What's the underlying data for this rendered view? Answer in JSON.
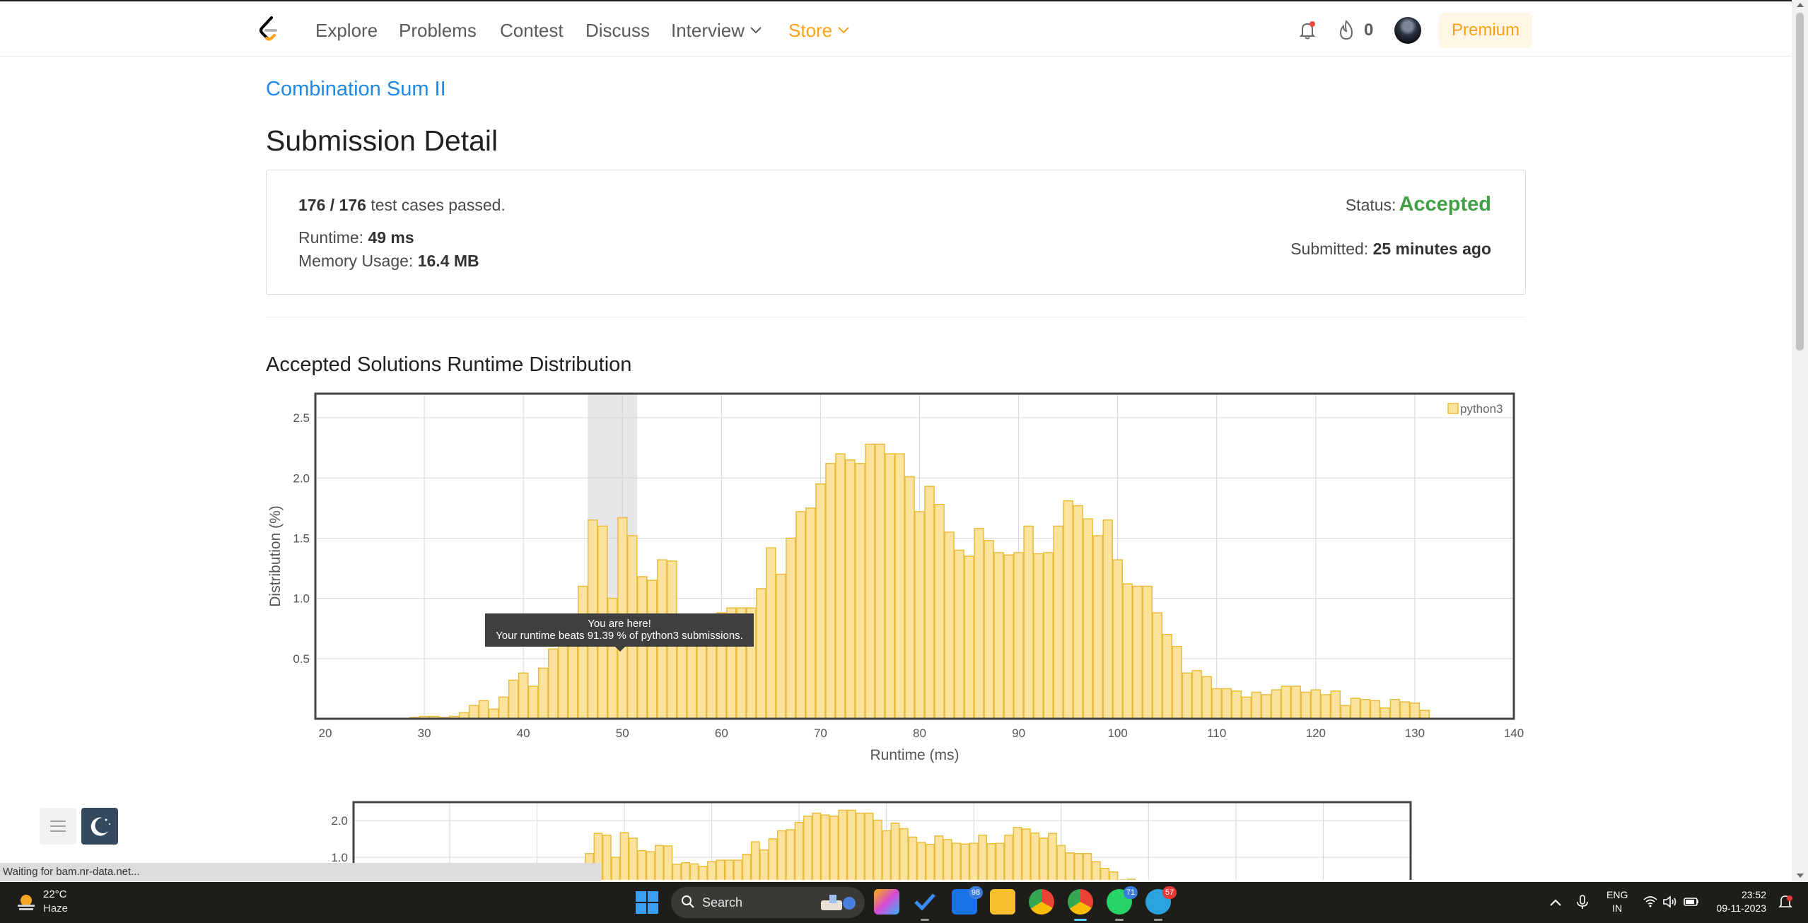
{
  "nav": {
    "links": [
      "Explore",
      "Problems",
      "Contest",
      "Discuss",
      "Interview",
      "Store"
    ],
    "streak_count": "0",
    "premium_label": "Premium"
  },
  "problem": {
    "title": "Combination Sum II"
  },
  "page_title": "Submission Detail",
  "summary": {
    "passed": "176 / 176",
    "passed_suffix": "test cases passed.",
    "runtime_label": "Runtime:",
    "runtime_value": "49 ms",
    "memory_label": "Memory Usage:",
    "memory_value": "16.4 MB",
    "status_label": "Status:",
    "status_value": "Accepted",
    "submitted_label": "Submitted:",
    "submitted_value": "25 minutes ago"
  },
  "distribution_title": "Accepted Solutions Runtime Distribution",
  "tooltip": {
    "line1": "You are here!",
    "line2": "Your runtime beats 91.39 % of python3 submissions."
  },
  "colors": {
    "accent": "#ffa116",
    "link": "#1e88e5",
    "accepted": "#43a047",
    "bar_fill": "#fbe29d",
    "bar_stroke": "#e8bd3a"
  },
  "chart_data": [
    {
      "type": "bar",
      "xlabel": "Runtime (ms)",
      "ylabel": "Distribution (%)",
      "xlim": [
        19,
        140
      ],
      "ylim": [
        0,
        2.7
      ],
      "x_ticks": [
        20,
        30,
        40,
        50,
        60,
        70,
        80,
        90,
        100,
        110,
        120,
        130,
        140
      ],
      "y_ticks": [
        0.5,
        1.0,
        1.5,
        2.0,
        2.5
      ],
      "y_tick_labels": [
        "0.5",
        "1.0",
        "1.5",
        "2.0",
        "2.5"
      ],
      "grid": true,
      "legend": "top-right",
      "highlight_range": [
        47,
        51
      ],
      "series": [
        {
          "name": "python3",
          "x": [
            29,
            30,
            31,
            32,
            33,
            34,
            35,
            36,
            37,
            38,
            39,
            40,
            41,
            42,
            43,
            44,
            45,
            46,
            47,
            48,
            49,
            50,
            51,
            52,
            53,
            54,
            55,
            56,
            57,
            58,
            59,
            60,
            61,
            62,
            63,
            64,
            65,
            66,
            67,
            68,
            69,
            70,
            71,
            72,
            73,
            74,
            75,
            76,
            77,
            78,
            79,
            80,
            81,
            82,
            83,
            84,
            85,
            86,
            87,
            88,
            89,
            90,
            91,
            92,
            93,
            94,
            95,
            96,
            97,
            98,
            99,
            100,
            101,
            102,
            103,
            104,
            105,
            106,
            107,
            108,
            109,
            110,
            111,
            112,
            113,
            114,
            115,
            116,
            117,
            118,
            119,
            120,
            121,
            122,
            123,
            124,
            125,
            126,
            127,
            128,
            129,
            130,
            131
          ],
          "values": [
            0.01,
            0.02,
            0.02,
            0.01,
            0.02,
            0.05,
            0.11,
            0.15,
            0.08,
            0.18,
            0.32,
            0.38,
            0.27,
            0.42,
            0.58,
            0.82,
            0.68,
            1.1,
            1.65,
            1.6,
            1.0,
            1.67,
            1.52,
            1.18,
            1.15,
            1.32,
            1.31,
            0.81,
            0.85,
            0.82,
            0.75,
            0.88,
            0.92,
            0.92,
            0.92,
            1.08,
            1.42,
            1.2,
            1.5,
            1.72,
            1.75,
            1.95,
            2.12,
            2.2,
            2.15,
            2.12,
            2.28,
            2.28,
            2.2,
            2.2,
            2.01,
            1.72,
            1.93,
            1.78,
            1.55,
            1.4,
            1.35,
            1.58,
            1.48,
            1.38,
            1.36,
            1.38,
            1.6,
            1.37,
            1.38,
            1.6,
            1.81,
            1.77,
            1.66,
            1.52,
            1.65,
            1.32,
            1.12,
            1.1,
            1.1,
            0.88,
            0.7,
            0.6,
            0.38,
            0.4,
            0.35,
            0.25,
            0.25,
            0.23,
            0.18,
            0.22,
            0.2,
            0.24,
            0.27,
            0.27,
            0.22,
            0.24,
            0.2,
            0.23,
            0.11,
            0.17,
            0.16,
            0.15,
            0.09,
            0.16,
            0.14,
            0.13,
            0.07
          ]
        }
      ]
    },
    {
      "type": "bar",
      "y_ticks": [
        1.0,
        2.0
      ],
      "y_tick_labels": [
        "1.0",
        "2.0"
      ],
      "xlim": [
        19,
        140
      ],
      "ylim": [
        0,
        2.5
      ],
      "grid": true,
      "series": [
        {
          "name": "python3",
          "x": [
            29,
            30,
            31,
            32,
            33,
            34,
            35,
            36,
            37,
            38,
            39,
            40,
            41,
            42,
            43,
            44,
            45,
            46,
            47,
            48,
            49,
            50,
            51,
            52,
            53,
            54,
            55,
            56,
            57,
            58,
            59,
            60,
            61,
            62,
            63,
            64,
            65,
            66,
            67,
            68,
            69,
            70,
            71,
            72,
            73,
            74,
            75,
            76,
            77,
            78,
            79,
            80,
            81,
            82,
            83,
            84,
            85,
            86,
            87,
            88,
            89,
            90,
            91,
            92,
            93,
            94,
            95,
            96,
            97,
            98,
            99,
            100,
            101,
            102,
            103,
            104,
            105,
            106,
            107,
            108,
            109,
            110,
            111,
            112,
            113,
            114,
            115,
            116,
            117,
            118,
            119,
            120,
            121,
            122,
            123,
            124,
            125,
            126,
            127,
            128,
            129,
            130,
            131
          ],
          "values": [
            0.01,
            0.02,
            0.02,
            0.01,
            0.02,
            0.05,
            0.11,
            0.15,
            0.08,
            0.18,
            0.32,
            0.38,
            0.27,
            0.42,
            0.58,
            0.82,
            0.68,
            1.1,
            1.65,
            1.6,
            1.0,
            1.67,
            1.52,
            1.18,
            1.15,
            1.32,
            1.31,
            0.81,
            0.85,
            0.82,
            0.75,
            0.88,
            0.92,
            0.92,
            0.92,
            1.08,
            1.42,
            1.2,
            1.5,
            1.72,
            1.75,
            1.95,
            2.12,
            2.2,
            2.15,
            2.12,
            2.28,
            2.28,
            2.2,
            2.2,
            2.01,
            1.72,
            1.93,
            1.78,
            1.55,
            1.4,
            1.35,
            1.58,
            1.48,
            1.38,
            1.36,
            1.38,
            1.6,
            1.37,
            1.38,
            1.6,
            1.81,
            1.77,
            1.66,
            1.52,
            1.65,
            1.32,
            1.12,
            1.1,
            1.1,
            0.88,
            0.7,
            0.6,
            0.38,
            0.4,
            0.35,
            0.25,
            0.25,
            0.23,
            0.18,
            0.22,
            0.2,
            0.24,
            0.27,
            0.27,
            0.22,
            0.24,
            0.2,
            0.23,
            0.11,
            0.17,
            0.16,
            0.15,
            0.09,
            0.16,
            0.14,
            0.13,
            0.07
          ]
        }
      ]
    }
  ],
  "browser_status": "Waiting for bam.nr-data.net...",
  "taskbar": {
    "weather_temp": "22°C",
    "weather_desc": "Haze",
    "search_label": "Search",
    "badges": [
      "98",
      "71",
      "57"
    ],
    "lang_line1": "ENG",
    "lang_line2": "IN",
    "time": "23:52",
    "date": "09-11-2023"
  }
}
